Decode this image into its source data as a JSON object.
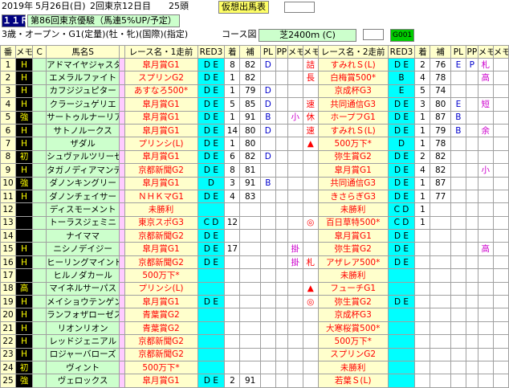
{
  "header": {
    "date": "2019年",
    "md": "5月26日(日)",
    "meet": "2回東京12日目",
    "heads": "25頭",
    "sheet_label": "仮想出馬表",
    "race_no": "１１Ｒ",
    "race_name": "第86回東京優駿（馬連5%UP/予定）",
    "condition": "3歳・オープン・G1(定量)(牡・牝)(国際)(指定)",
    "course_label": "コース図",
    "course_value": "芝2400ｍ (C)",
    "code": "G001"
  },
  "columns": [
    "番",
    "メモ",
    "C",
    "馬名S",
    "",
    "レース名・1走前",
    "RED3",
    "着",
    "補",
    "PL",
    "PP",
    "メモ",
    "メモ",
    "レース名・2走前",
    "RED3",
    "着",
    "補",
    "PL",
    "PP",
    "メモ",
    "メモ"
  ],
  "rows": [
    {
      "no": "1",
      "mark": "H",
      "name": "アドマイヤジャスタ",
      "r1": "皐月賞G1",
      "red1": "D E",
      "c1": "8",
      "h1": "82",
      "pl1": "D",
      "pp1": "",
      "m1a": "",
      "m1b": "詰",
      "r2": "すみれＳ(L)",
      "red2": "D E",
      "c2": "2",
      "h2": "76",
      "pl2": "E",
      "pp2": "P",
      "m2a": "札",
      "m2b": ""
    },
    {
      "no": "2",
      "mark": "H",
      "name": "エメラルファイト",
      "r1": "スプリンG2",
      "red1": "D E",
      "c1": "1",
      "h1": "82",
      "pl1": "",
      "pp1": "",
      "m1a": "",
      "m1b": "長",
      "r2": "白梅賞500*",
      "red2": "B",
      "c2": "4",
      "h2": "78",
      "pl2": "",
      "pp2": "",
      "m2a": "高",
      "m2b": ""
    },
    {
      "no": "3",
      "mark": "H",
      "name": "カフジジュピター",
      "r1": "あすなろ500*",
      "red1": "D E",
      "c1": "1",
      "h1": "79",
      "pl1": "D",
      "pp1": "",
      "m1a": "",
      "m1b": "",
      "r2": "京成杯G3",
      "red2": "E",
      "c2": "5",
      "h2": "74",
      "pl2": "",
      "pp2": "",
      "m2a": "",
      "m2b": ""
    },
    {
      "no": "4",
      "mark": "H",
      "name": "クラージュゲリエ",
      "r1": "皐月賞G1",
      "red1": "D E",
      "c1": "5",
      "h1": "85",
      "pl1": "D",
      "pp1": "",
      "m1a": "",
      "m1b": "速",
      "r2": "共同通信G3",
      "red2": "D E",
      "c2": "3",
      "h2": "80",
      "pl2": "E",
      "pp2": "",
      "m2a": "短",
      "m2b": ""
    },
    {
      "no": "5",
      "mark": "強",
      "name": "サートゥルナーリア",
      "r1": "皐月賞G1",
      "red1": "D E",
      "c1": "1",
      "h1": "91",
      "pl1": "B",
      "pp1": "",
      "m1a": "小",
      "m1b": "休",
      "r2": "ホープフG1",
      "red2": "D E",
      "c2": "1",
      "h2": "87",
      "pl2": "B",
      "pp2": "",
      "m2a": "",
      "m2b": ""
    },
    {
      "no": "6",
      "mark": "H",
      "name": "サトノルークス",
      "r1": "皐月賞G1",
      "red1": "D E",
      "c1": "14",
      "h1": "80",
      "pl1": "D",
      "pp1": "",
      "m1a": "",
      "m1b": "速",
      "r2": "すみれＳ(L)",
      "red2": "D E",
      "c2": "1",
      "h2": "79",
      "pl2": "B",
      "pp2": "",
      "m2a": "余",
      "m2b": ""
    },
    {
      "no": "7",
      "mark": "H",
      "name": "ザダル",
      "r1": "プリンシ(L)",
      "red1": "D E",
      "c1": "1",
      "h1": "80",
      "pl1": "",
      "pp1": "",
      "m1a": "",
      "m1b": "▲",
      "r2": "500万下*",
      "red2": "D",
      "c2": "1",
      "h2": "78",
      "pl2": "",
      "pp2": "",
      "m2a": "",
      "m2b": ""
    },
    {
      "no": "8",
      "mark": "初",
      "name": "シュヴァルツリーゼ",
      "r1": "皐月賞G1",
      "red1": "D E",
      "c1": "6",
      "h1": "82",
      "pl1": "D",
      "pp1": "",
      "m1a": "",
      "m1b": "",
      "r2": "弥生賞G2",
      "red2": "D E",
      "c2": "2",
      "h2": "82",
      "pl2": "",
      "pp2": "",
      "m2a": "",
      "m2b": ""
    },
    {
      "no": "9",
      "mark": "H",
      "name": "タガノディアマンテ",
      "r1": "京都新聞G2",
      "red1": "D E",
      "c1": "8",
      "h1": "81",
      "pl1": "",
      "pp1": "",
      "m1a": "",
      "m1b": "",
      "r2": "皐月賞G1",
      "red2": "D E",
      "c2": "4",
      "h2": "82",
      "pl2": "",
      "pp2": "",
      "m2a": "小",
      "m2b": ""
    },
    {
      "no": "10",
      "mark": "強",
      "name": "ダノンキングリー",
      "r1": "皐月賞G1",
      "red1": "D",
      "c1": "3",
      "h1": "91",
      "pl1": "B",
      "pp1": "",
      "m1a": "",
      "m1b": "",
      "r2": "共同通信G3",
      "red2": "D E",
      "c2": "1",
      "h2": "87",
      "pl2": "",
      "pp2": "",
      "m2a": "",
      "m2b": ""
    },
    {
      "no": "11",
      "mark": "H",
      "name": "ダノンチェイサー",
      "r1": "ＮＨＫマG1",
      "red1": "D E",
      "c1": "4",
      "h1": "83",
      "pl1": "",
      "pp1": "",
      "m1a": "",
      "m1b": "",
      "r2": "きさらぎG3",
      "red2": "D E",
      "c2": "1",
      "h2": "77",
      "pl2": "",
      "pp2": "",
      "m2a": "",
      "m2b": ""
    },
    {
      "no": "12",
      "mark": "",
      "name": "ディスモーメント",
      "r1": "未勝利",
      "red1": "",
      "c1": "",
      "h1": "",
      "pl1": "",
      "pp1": "",
      "m1a": "",
      "m1b": "",
      "r2": "未勝利",
      "red2": "C D",
      "c2": "1",
      "h2": "",
      "pl2": "",
      "pp2": "",
      "m2a": "",
      "m2b": ""
    },
    {
      "no": "13",
      "mark": "",
      "name": "トーラスジェミニ",
      "r1": "東京スポG3",
      "red1": "C D",
      "c1": "12",
      "h1": "",
      "pl1": "",
      "pp1": "",
      "m1a": "",
      "m1b": "◎",
      "r2": "百日草特500*",
      "red2": "C D",
      "c2": "1",
      "h2": "",
      "pl2": "",
      "pp2": "",
      "m2a": "",
      "m2b": ""
    },
    {
      "no": "14",
      "mark": "",
      "name": "ナイママ",
      "r1": "京都新聞G2",
      "red1": "D E",
      "c1": "",
      "h1": "",
      "pl1": "",
      "pp1": "",
      "m1a": "",
      "m1b": "",
      "r2": "皐月賞G1",
      "red2": "D E",
      "c2": "",
      "h2": "",
      "pl2": "",
      "pp2": "",
      "m2a": "",
      "m2b": ""
    },
    {
      "no": "15",
      "mark": "H",
      "name": "ニシノデイジー",
      "r1": "皐月賞G1",
      "red1": "D E",
      "c1": "17",
      "h1": "",
      "pl1": "",
      "pp1": "",
      "m1a": "掛",
      "m1b": "",
      "r2": "弥生賞G2",
      "red2": "D E",
      "c2": "",
      "h2": "",
      "pl2": "",
      "pp2": "",
      "m2a": "高",
      "m2b": ""
    },
    {
      "no": "16",
      "mark": "H",
      "name": "ヒーリングマインド",
      "r1": "京都新聞G2",
      "red1": "D E",
      "c1": "",
      "h1": "",
      "pl1": "",
      "pp1": "",
      "m1a": "掛",
      "m1b": "札",
      "r2": "アザレア500*",
      "red2": "D E",
      "c2": "",
      "h2": "",
      "pl2": "",
      "pp2": "",
      "m2a": "",
      "m2b": ""
    },
    {
      "no": "17",
      "mark": "",
      "name": "ヒルノダカール",
      "r1": "500万下*",
      "red1": "",
      "c1": "",
      "h1": "",
      "pl1": "",
      "pp1": "",
      "m1a": "",
      "m1b": "",
      "r2": "未勝利",
      "red2": "",
      "c2": "",
      "h2": "",
      "pl2": "",
      "pp2": "",
      "m2a": "",
      "m2b": ""
    },
    {
      "no": "18",
      "mark": "高",
      "name": "マイネルサーパス",
      "r1": "プリンシ(L)",
      "red1": "",
      "c1": "",
      "h1": "",
      "pl1": "",
      "pp1": "",
      "m1a": "",
      "m1b": "▲",
      "r2": "フューチG1",
      "red2": "",
      "c2": "",
      "h2": "",
      "pl2": "",
      "pp2": "",
      "m2a": "",
      "m2b": ""
    },
    {
      "no": "19",
      "mark": "H",
      "name": "メイショウテンゲン",
      "r1": "皐月賞G1",
      "red1": "D E",
      "c1": "",
      "h1": "",
      "pl1": "",
      "pp1": "",
      "m1a": "",
      "m1b": "◎",
      "r2": "弥生賞G2",
      "red2": "D E",
      "c2": "",
      "h2": "",
      "pl2": "",
      "pp2": "",
      "m2a": "",
      "m2b": ""
    },
    {
      "no": "20",
      "mark": "H",
      "name": "ランフォザローゼス",
      "r1": "青葉賞G2",
      "red1": "",
      "c1": "",
      "h1": "",
      "pl1": "",
      "pp1": "",
      "m1a": "",
      "m1b": "",
      "r2": "京成杯G3",
      "red2": "",
      "c2": "",
      "h2": "",
      "pl2": "",
      "pp2": "",
      "m2a": "",
      "m2b": ""
    },
    {
      "no": "21",
      "mark": "H",
      "name": "リオンリオン",
      "r1": "青葉賞G2",
      "red1": "",
      "c1": "",
      "h1": "",
      "pl1": "",
      "pp1": "",
      "m1a": "",
      "m1b": "",
      "r2": "大寒桜賞500*",
      "red2": "",
      "c2": "",
      "h2": "",
      "pl2": "",
      "pp2": "",
      "m2a": "",
      "m2b": ""
    },
    {
      "no": "22",
      "mark": "H",
      "name": "レッドジェニアル",
      "r1": "京都新聞G2",
      "red1": "",
      "c1": "",
      "h1": "",
      "pl1": "",
      "pp1": "",
      "m1a": "",
      "m1b": "",
      "r2": "500万下*",
      "red2": "",
      "c2": "",
      "h2": "",
      "pl2": "",
      "pp2": "",
      "m2a": "",
      "m2b": ""
    },
    {
      "no": "23",
      "mark": "H",
      "name": "ロジャーバローズ",
      "r1": "京都新聞G2",
      "red1": "",
      "c1": "",
      "h1": "",
      "pl1": "",
      "pp1": "",
      "m1a": "",
      "m1b": "",
      "r2": "スプリンG2",
      "red2": "",
      "c2": "",
      "h2": "",
      "pl2": "",
      "pp2": "",
      "m2a": "",
      "m2b": ""
    },
    {
      "no": "24",
      "mark": "初",
      "name": "ヴィント",
      "r1": "500万下*",
      "red1": "",
      "c1": "",
      "h1": "",
      "pl1": "",
      "pp1": "",
      "m1a": "",
      "m1b": "",
      "r2": "未勝利",
      "red2": "",
      "c2": "",
      "h2": "",
      "pl2": "",
      "pp2": "",
      "m2a": "",
      "m2b": ""
    },
    {
      "no": "25",
      "mark": "強",
      "name": "ヴェロックス",
      "r1": "皐月賞G1",
      "red1": "D E",
      "c1": "2",
      "h1": "91",
      "pl1": "",
      "pp1": "",
      "m1a": "",
      "m1b": "",
      "r2": "若葉Ｓ(L)",
      "red2": "",
      "c2": "",
      "h2": "",
      "pl2": "",
      "pp2": "",
      "m2a": "",
      "m2b": ""
    }
  ]
}
